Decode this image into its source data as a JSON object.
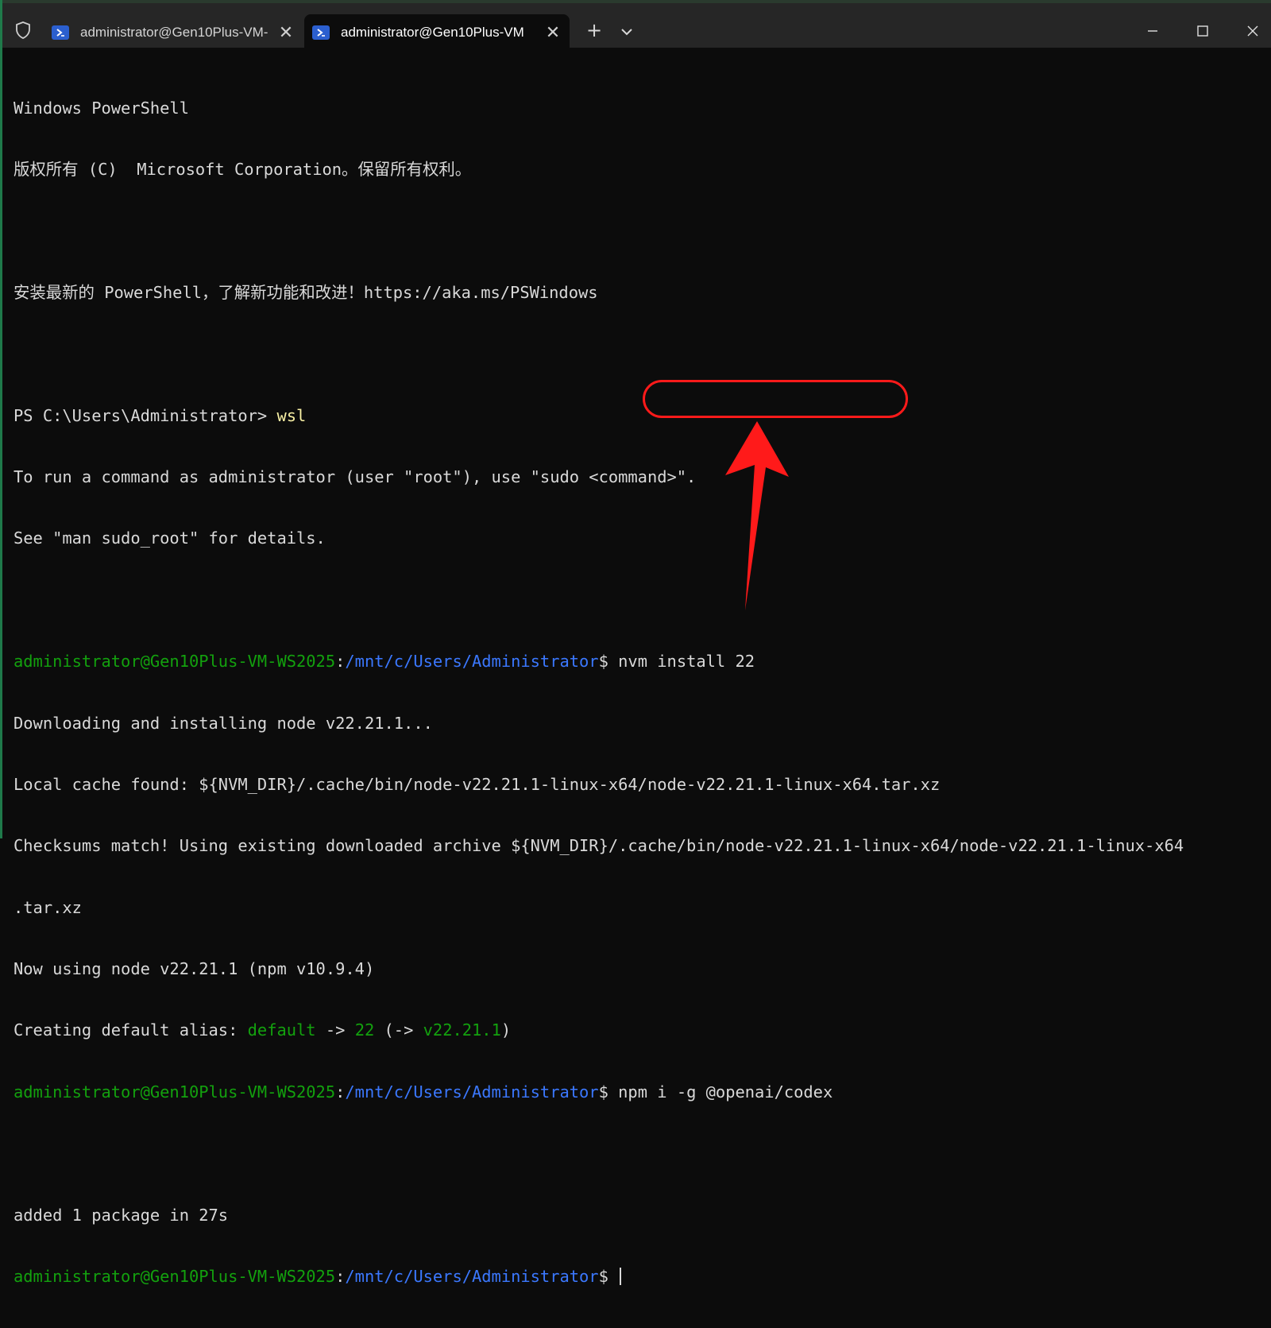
{
  "tabs": [
    {
      "title": "administrator@Gen10Plus-VM-",
      "close": "✕",
      "active": false
    },
    {
      "title": "administrator@Gen10Plus-VM",
      "close": "✕",
      "active": true
    }
  ],
  "new_tab_label": "+",
  "window_controls": {
    "minimize": "minimize",
    "maximize": "maximize",
    "close": "close"
  },
  "terminal": {
    "l1": "Windows PowerShell",
    "l2": "版权所有 (C)  Microsoft Corporation。保留所有权利。",
    "l3": "安装最新的 PowerShell，了解新功能和改进！https://aka.ms/PSWindows",
    "l4_prompt": "PS C:\\Users\\Administrator> ",
    "l4_cmd": "wsl",
    "l5": "To run a command as administrator (user \"root\"), use \"sudo <command>\".",
    "l6": "See \"man sudo_root\" for details.",
    "user_host": "administrator@Gen10Plus-VM-WS2025",
    "colon": ":",
    "path": "/mnt/c/Users/Administrator",
    "dollar": "$ ",
    "cmd1": "nvm install 22",
    "o1": "Downloading and installing node v22.21.1...",
    "o2": "Local cache found: ${NVM_DIR}/.cache/bin/node-v22.21.1-linux-x64/node-v22.21.1-linux-x64.tar.xz",
    "o3": "Checksums match! Using existing downloaded archive ${NVM_DIR}/.cache/bin/node-v22.21.1-linux-x64/node-v22.21.1-linux-x64",
    "o4": ".tar.xz",
    "o5": "Now using node v22.21.1 (npm v10.9.4)",
    "o6_a": "Creating default alias: ",
    "o6_b": "default",
    "o6_c": " -> ",
    "o6_d": "22",
    "o6_e": " (-> ",
    "o6_f": "v22.21.1",
    "o6_g": ")",
    "cmd2": "npm i -g @openai/codex",
    "o7": "added 1 package in 27s"
  },
  "colors": {
    "prompt_user": "#13a10e",
    "prompt_path": "#3b78ff",
    "command_yellow": "#f9f1a5",
    "annotation_red": "#ff1a1a",
    "background": "#0c0c0c"
  }
}
